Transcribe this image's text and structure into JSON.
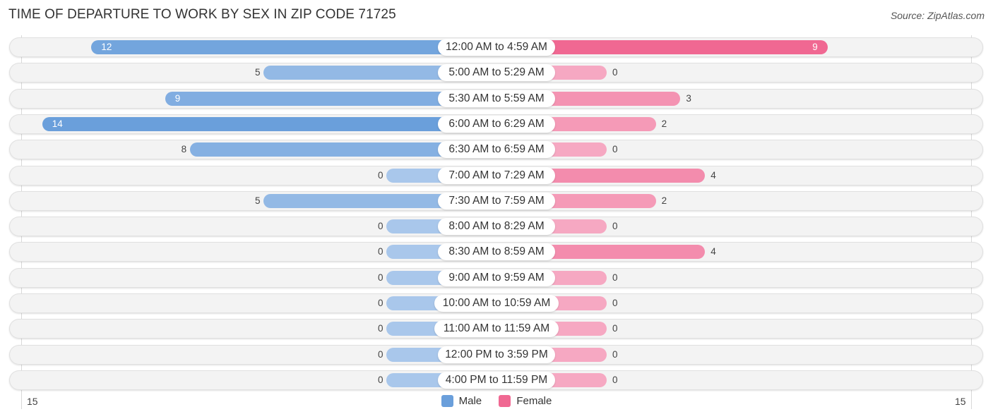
{
  "header": {
    "title": "TIME OF DEPARTURE TO WORK BY SEX IN ZIP CODE 71725",
    "source": "Source: ZipAtlas.com"
  },
  "colors": {
    "male_strong": "#6a9fdb",
    "male_light": "#a9c7eb",
    "female_strong": "#f06892",
    "female_light": "#f6a8c2"
  },
  "chart_data": {
    "type": "bar",
    "orientation": "horizontal-diverging",
    "title": "TIME OF DEPARTURE TO WORK BY SEX IN ZIP CODE 71725",
    "categories": [
      "12:00 AM to 4:59 AM",
      "5:00 AM to 5:29 AM",
      "5:30 AM to 5:59 AM",
      "6:00 AM to 6:29 AM",
      "6:30 AM to 6:59 AM",
      "7:00 AM to 7:29 AM",
      "7:30 AM to 7:59 AM",
      "8:00 AM to 8:29 AM",
      "8:30 AM to 8:59 AM",
      "9:00 AM to 9:59 AM",
      "10:00 AM to 10:59 AM",
      "11:00 AM to 11:59 AM",
      "12:00 PM to 3:59 PM",
      "4:00 PM to 11:59 PM"
    ],
    "series": [
      {
        "name": "Male",
        "values": [
          12,
          5,
          9,
          14,
          8,
          0,
          5,
          0,
          0,
          0,
          0,
          0,
          0,
          0
        ]
      },
      {
        "name": "Female",
        "values": [
          9,
          0,
          3,
          2,
          0,
          4,
          2,
          0,
          4,
          0,
          0,
          0,
          0,
          0
        ]
      }
    ],
    "axis": {
      "left_label": "15",
      "right_label": "15",
      "range": [
        0,
        15
      ]
    },
    "legend": {
      "position": "bottom-center",
      "entries": [
        "Male",
        "Female"
      ]
    },
    "grid": false
  }
}
